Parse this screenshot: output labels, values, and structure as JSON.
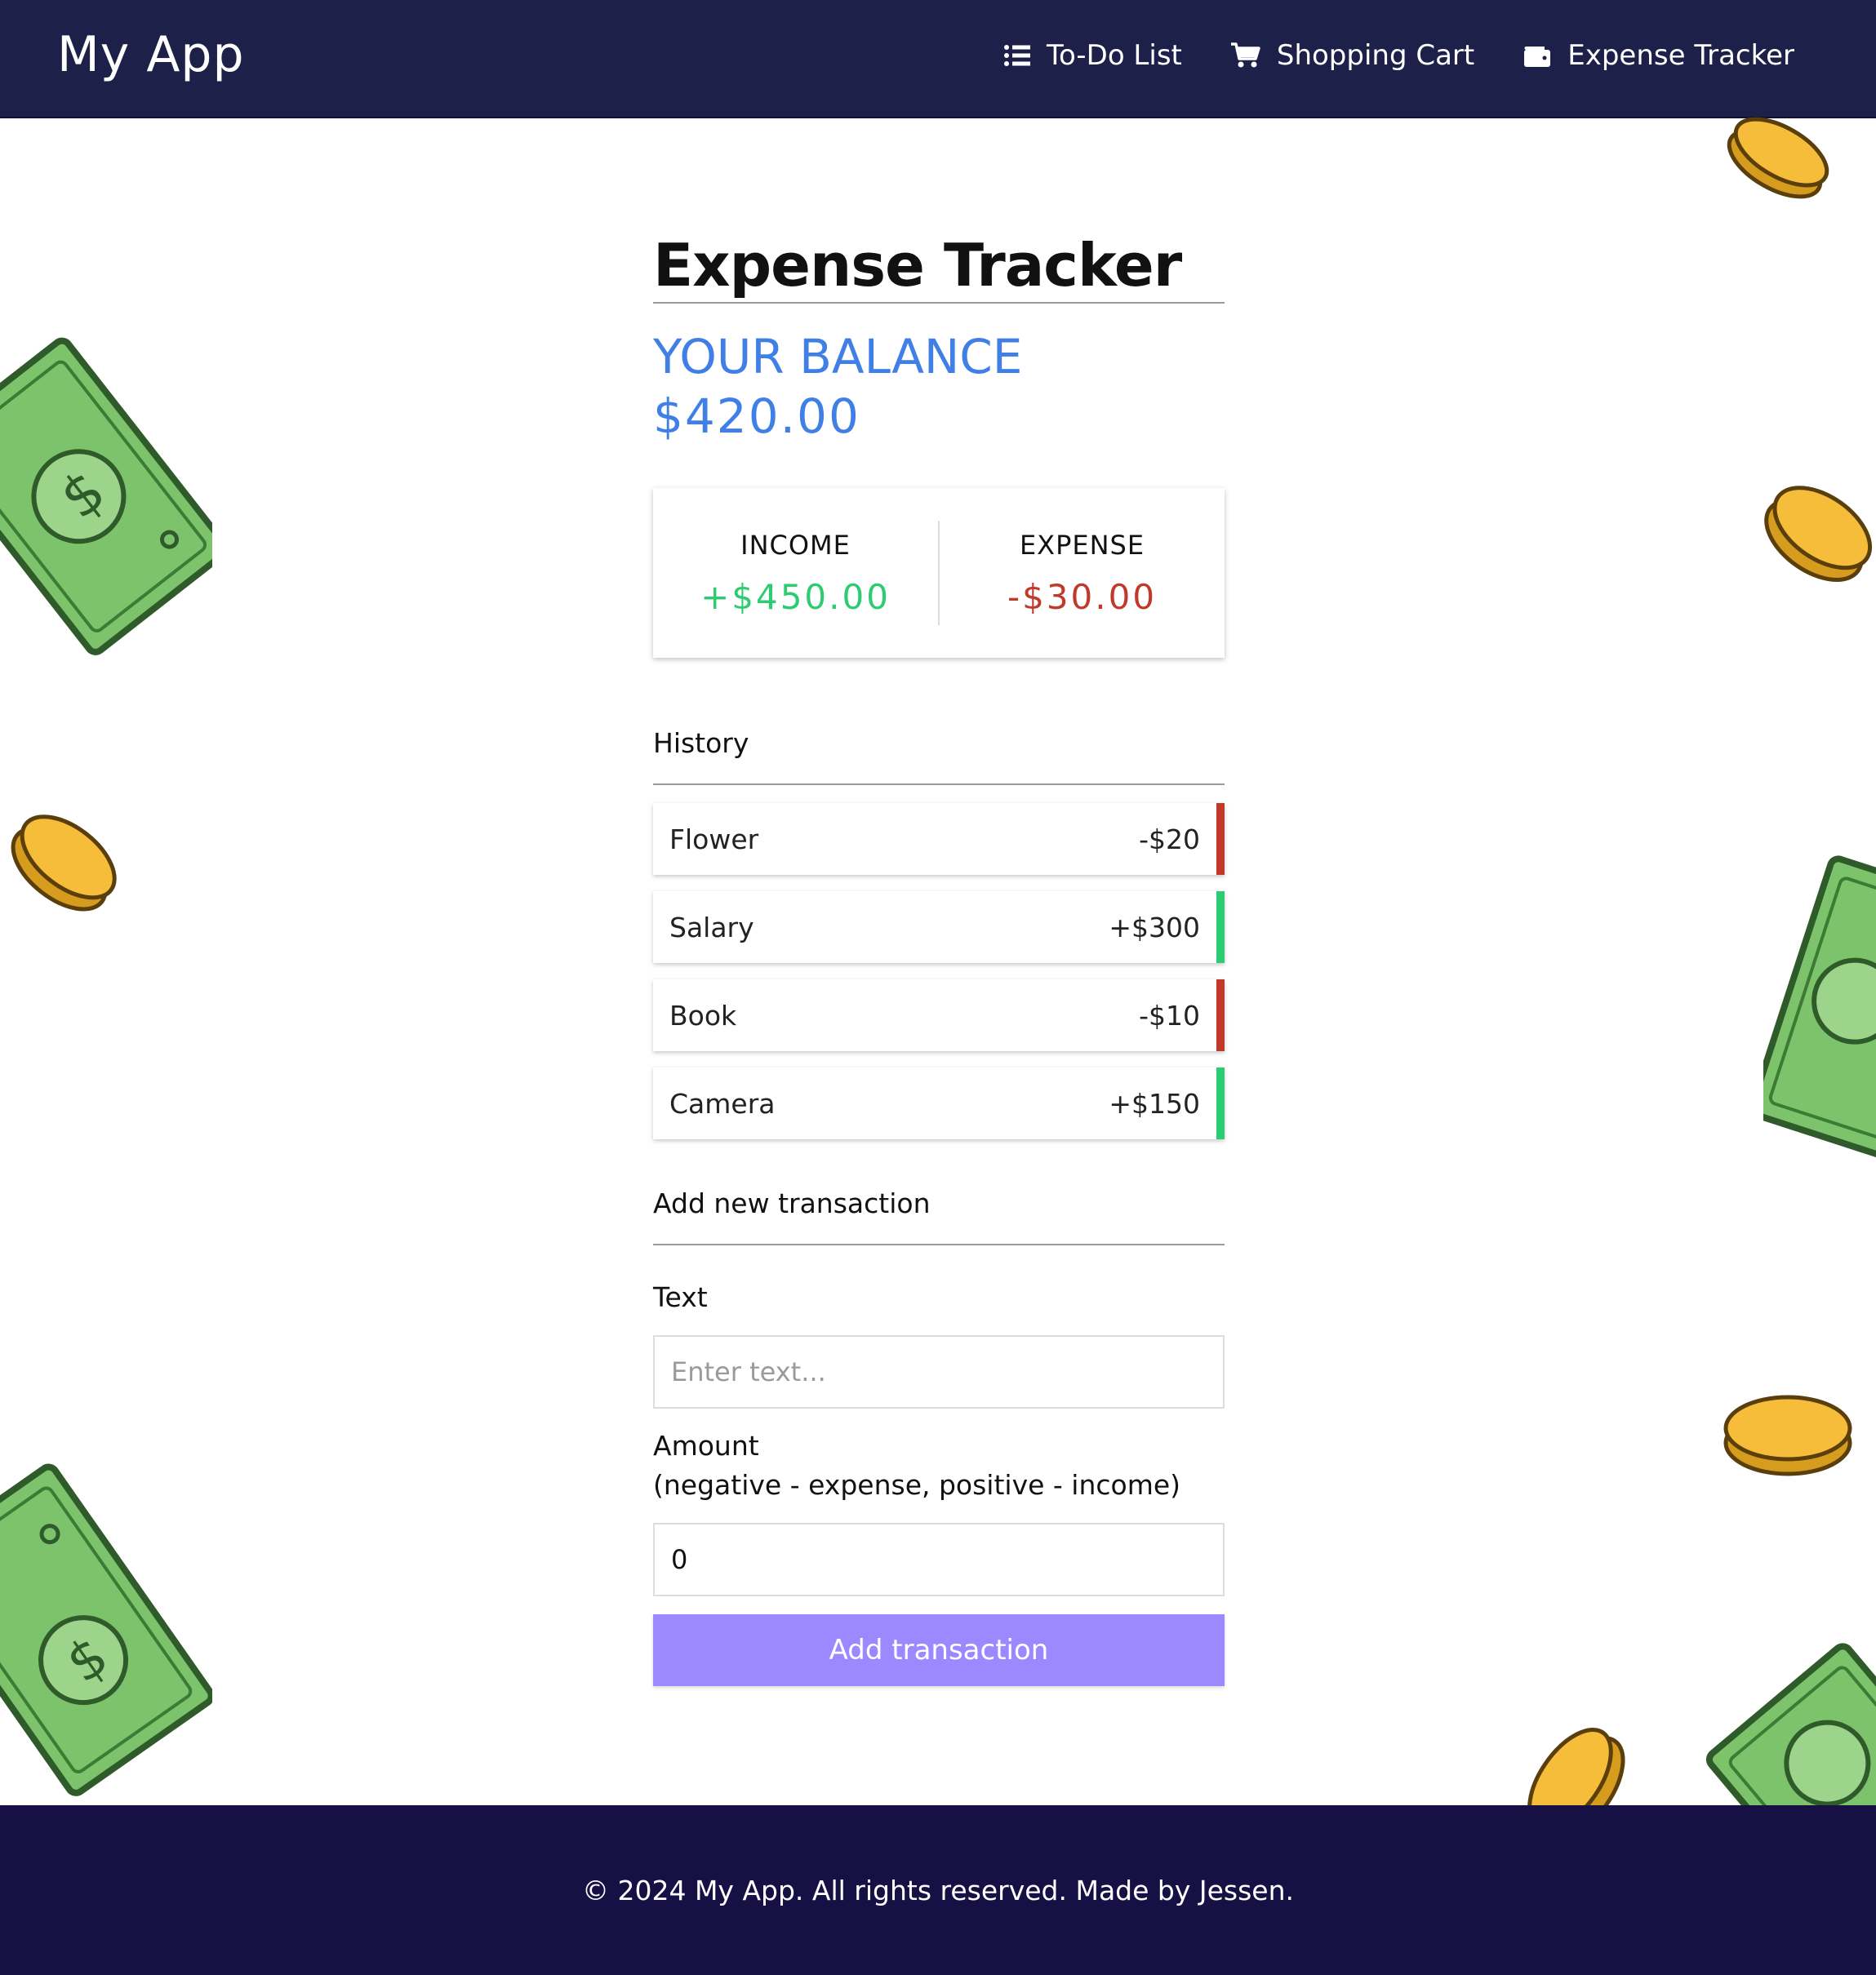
{
  "header": {
    "brand": "My App",
    "nav": [
      {
        "label": "To-Do List",
        "icon": "list-icon"
      },
      {
        "label": "Shopping Cart",
        "icon": "cart-icon"
      },
      {
        "label": "Expense Tracker",
        "icon": "wallet-icon"
      }
    ]
  },
  "main": {
    "title": "Expense Tracker",
    "balance_label": "YOUR BALANCE",
    "balance_value": "$420.00",
    "summary": {
      "income_label": "INCOME",
      "income_value": "+$450.00",
      "expense_label": "EXPENSE",
      "expense_value": "-$30.00"
    },
    "history_heading": "History",
    "history": [
      {
        "text": "Flower",
        "amount": "-$20",
        "type": "expense"
      },
      {
        "text": "Salary",
        "amount": "+$300",
        "type": "income"
      },
      {
        "text": "Book",
        "amount": "-$10",
        "type": "expense"
      },
      {
        "text": "Camera",
        "amount": "+$150",
        "type": "income"
      }
    ],
    "form": {
      "heading": "Add new transaction",
      "text_label": "Text",
      "text_placeholder": "Enter text...",
      "amount_label_line1": "Amount",
      "amount_label_line2": "(negative - expense, positive - income)",
      "amount_value": "0",
      "button_label": "Add transaction"
    }
  },
  "footer": {
    "text": "© 2024 My App. All rights reserved. Made by Jessen."
  },
  "colors": {
    "header_bg": "#1d2049",
    "footer_bg": "#161044",
    "balance": "#3f7fe6",
    "income": "#2ecc71",
    "expense": "#c0392b",
    "button": "#9c88ff"
  }
}
